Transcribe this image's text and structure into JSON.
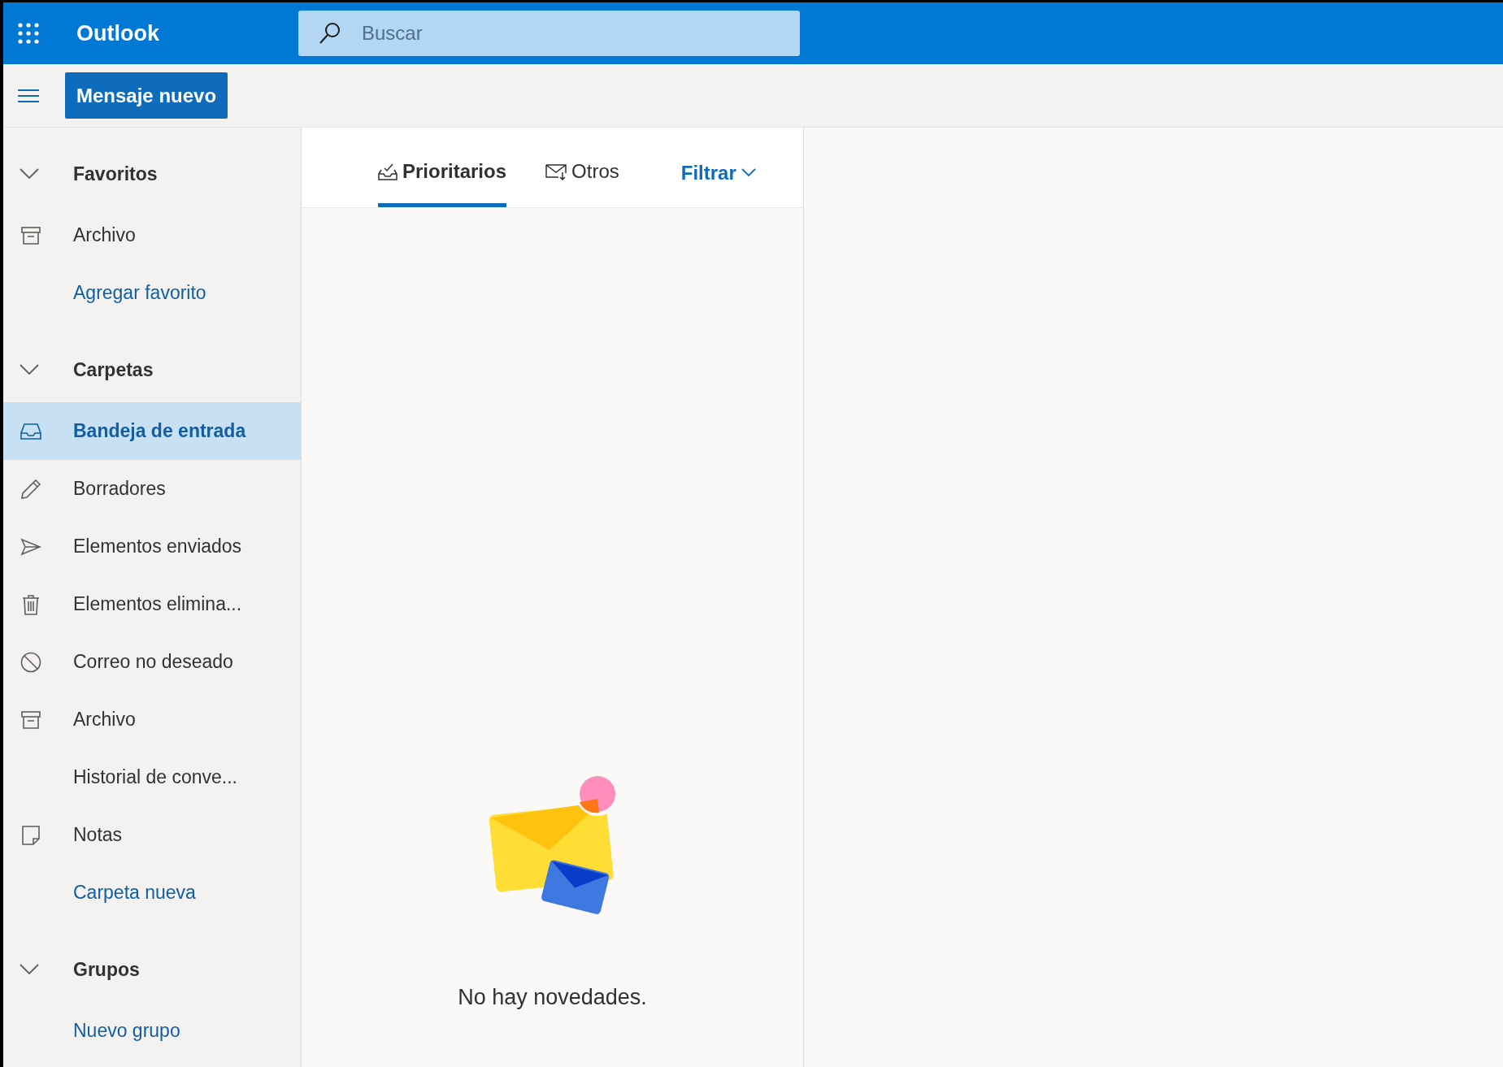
{
  "app": {
    "title": "Outlook"
  },
  "search": {
    "placeholder": "Buscar"
  },
  "new_message_button": "Mensaje nuevo",
  "sidebar": {
    "sections": [
      {
        "label": "Favoritos",
        "expanded": true,
        "items": [
          {
            "label": "Archivo",
            "kind": "archive",
            "selected": false
          },
          {
            "label": "Agregar favorito",
            "kind": "link",
            "selected": false
          }
        ]
      },
      {
        "label": "Carpetas",
        "expanded": true,
        "items": [
          {
            "label": "Bandeja de entrada",
            "kind": "inbox",
            "selected": true
          },
          {
            "label": "Borradores",
            "kind": "drafts",
            "selected": false
          },
          {
            "label": "Elementos enviados",
            "kind": "sent",
            "selected": false
          },
          {
            "label": "Elementos elimina...",
            "kind": "deleted",
            "selected": false
          },
          {
            "label": "Correo no deseado",
            "kind": "junk",
            "selected": false
          },
          {
            "label": "Archivo",
            "kind": "archive",
            "selected": false
          },
          {
            "label": "Historial de conve...",
            "kind": "plain",
            "selected": false
          },
          {
            "label": "Notas",
            "kind": "notes",
            "selected": false
          },
          {
            "label": "Carpeta nueva",
            "kind": "link",
            "selected": false
          }
        ]
      },
      {
        "label": "Grupos",
        "expanded": true,
        "items": [
          {
            "label": "Nuevo grupo",
            "kind": "link",
            "selected": false
          }
        ]
      }
    ]
  },
  "tabs": [
    {
      "label": "Prioritarios",
      "kind": "focused",
      "selected": true
    },
    {
      "label": "Otros",
      "kind": "other",
      "selected": false
    }
  ],
  "filter_button": "Filtrar",
  "empty_state": {
    "message": "No hay novedades."
  }
}
